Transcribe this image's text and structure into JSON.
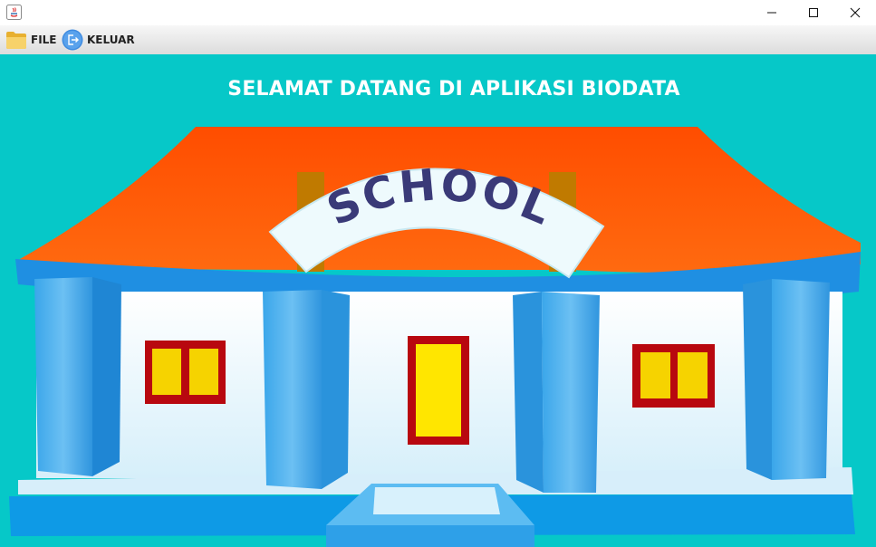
{
  "window": {
    "title": "",
    "controls": {
      "minimize": "minimize-icon",
      "maximize": "maximize-icon",
      "close": "close-icon"
    }
  },
  "menubar": {
    "items": [
      {
        "label": "FILE",
        "icon": "folder-icon"
      },
      {
        "label": "KELUAR",
        "icon": "exit-icon"
      }
    ]
  },
  "content": {
    "heading": "SELAMAT DATANG DI APLIKASI BIODATA",
    "illustration": {
      "sign_text": "SCHOOL"
    }
  },
  "colors": {
    "background": "#06c8c8",
    "heading_text": "#ffffff",
    "roof": "#ff5a00",
    "building_blue": "#2b9be6",
    "sign_text": "#3a3a78"
  }
}
